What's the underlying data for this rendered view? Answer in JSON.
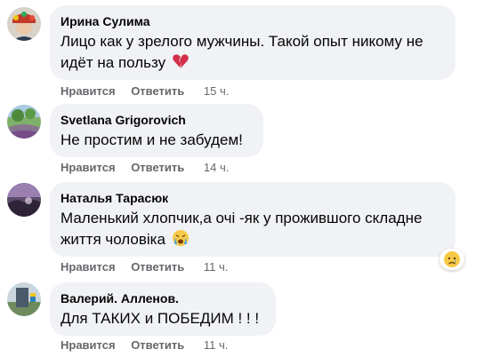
{
  "comments": [
    {
      "author": "Ирина Сулима",
      "text": "Лицо как у зрелого мужчины. Такой опыт никому не идёт на пользу",
      "emoji": "broken-heart-icon",
      "like_label": "Нравится",
      "reply_label": "Ответить",
      "time": "15 ч."
    },
    {
      "author": "Svetlana Grigorovich",
      "text": "Не простим и не забудем!",
      "like_label": "Нравится",
      "reply_label": "Ответить",
      "time": "14 ч."
    },
    {
      "author": "Наталья Тарасюк",
      "text": "Маленький хлопчик,а очі -як у прожившого складне життя чоловіка",
      "emoji": "crying-face-icon",
      "reaction": "sad-face-icon",
      "like_label": "Нравится",
      "reply_label": "Ответить",
      "time": "11 ч."
    },
    {
      "author": "Валерий. Алленов.",
      "text": "Для ТАКИХ и ПОБЕДИМ ! ! !",
      "like_label": "Нравится",
      "reply_label": "Ответить",
      "time": "11 ч."
    }
  ],
  "colors": {
    "bubble_bg": "#f0f2f5",
    "text": "#050505",
    "secondary": "#65676b"
  }
}
